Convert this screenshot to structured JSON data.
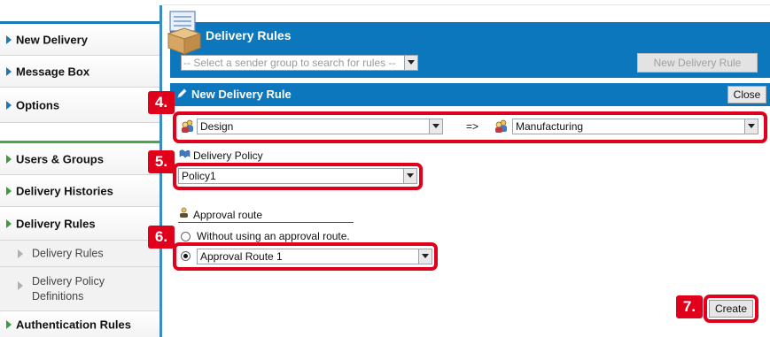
{
  "sidebar": {
    "top_items": [
      "New Delivery",
      "Message Box",
      "Options"
    ],
    "admin_items": [
      "Users & Groups",
      "Delivery Histories",
      "Delivery Rules"
    ],
    "sub_items": [
      "Delivery Rules",
      "Delivery Policy Definitions"
    ],
    "bottom_item": "Authentication Rules"
  },
  "header": {
    "title": "Delivery Rules",
    "sender_select_placeholder": "-- Select a sender group to search for rules --",
    "new_rule_button": "New Delivery Rule"
  },
  "panel": {
    "title": "New Delivery Rule",
    "close_button": "Close",
    "from_group": "Design",
    "arrow_text": "=>",
    "to_group": "Manufacturing",
    "policy_label": "Delivery Policy",
    "policy_value": "Policy1",
    "approval_label": "Approval route",
    "option_without": "Without using an approval route.",
    "route_value": "Approval Route 1",
    "create_button": "Create"
  },
  "steps": [
    "4.",
    "5.",
    "6.",
    "7."
  ],
  "colors": {
    "accent": "#0d77bd",
    "highlight": "#e0001b",
    "nav_green": "#3c9b3e"
  },
  "icons": [
    "package-icon",
    "pencil-icon",
    "group-icon",
    "policy-icon",
    "approval-icon"
  ]
}
